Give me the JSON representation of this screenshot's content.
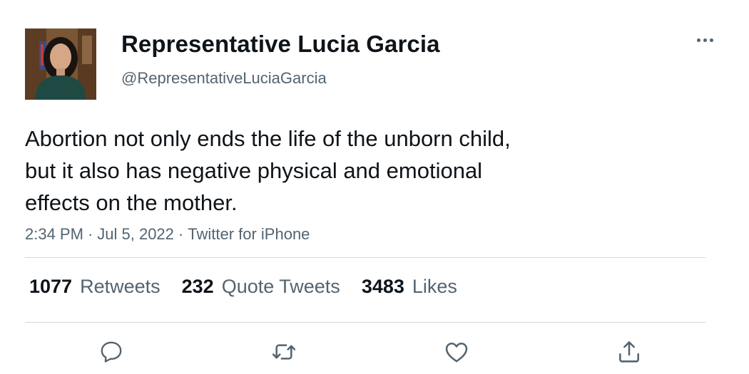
{
  "author": {
    "display_name": "Representative Lucia Garcia",
    "handle": "@RepresentativeLuciaGarcia"
  },
  "tweet": {
    "text_lines": [
      "Abortion not only ends the life of the unborn child,",
      "but it also has negative physical and emotional",
      "effects on the mother."
    ],
    "time": "2:34 PM",
    "date": "Jul 5, 2022",
    "source": "Twitter for iPhone",
    "separator": "·"
  },
  "stats": [
    {
      "count": "1077",
      "label": "Retweets"
    },
    {
      "count": "232",
      "label": "Quote Tweets"
    },
    {
      "count": "3483",
      "label": "Likes"
    }
  ],
  "icons": {
    "more": "more-horizontal-icon",
    "reply": "speech-bubble-icon",
    "retweet": "retweet-arrows-icon",
    "like": "heart-icon",
    "share": "share-upload-icon"
  },
  "colors": {
    "text_primary": "#0f1419",
    "text_secondary": "#536471",
    "divider": "#cfd9de"
  }
}
